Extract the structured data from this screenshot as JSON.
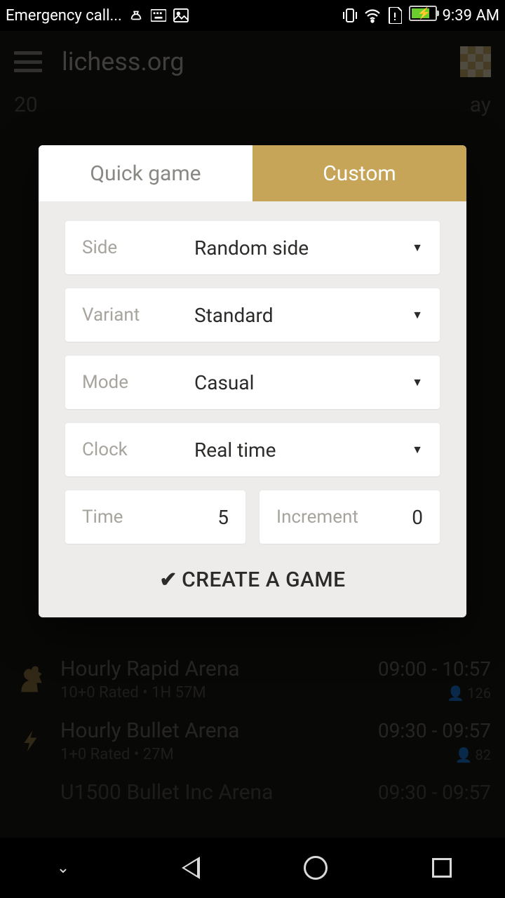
{
  "statusbar": {
    "headline": "Emergency call...",
    "clock": "9:39 AM"
  },
  "header": {
    "title": "lichess.org"
  },
  "bg": {
    "left": "20",
    "right": "ay"
  },
  "modal": {
    "tabs": {
      "quick": "Quick game",
      "custom": "Custom"
    },
    "side": {
      "label": "Side",
      "value": "Random side"
    },
    "variant": {
      "label": "Variant",
      "value": "Standard"
    },
    "mode": {
      "label": "Mode",
      "value": "Casual"
    },
    "clock": {
      "label": "Clock",
      "value": "Real time"
    },
    "time": {
      "label": "Time",
      "value": "5"
    },
    "increment": {
      "label": "Increment",
      "value": "0"
    },
    "create": "CREATE A GAME"
  },
  "tournaments": [
    {
      "name": "Hourly Rapid Arena",
      "desc": "10+0 Rated • 1H 57M",
      "time": "09:00 - 10:57",
      "players": "126"
    },
    {
      "name": "Hourly Bullet Arena",
      "desc": "1+0 Rated • 27M",
      "time": "09:30 - 09:57",
      "players": "82"
    },
    {
      "name": "U1500 Bullet Inc Arena",
      "desc": "",
      "time": "09:30 - 09:57",
      "players": ""
    }
  ]
}
